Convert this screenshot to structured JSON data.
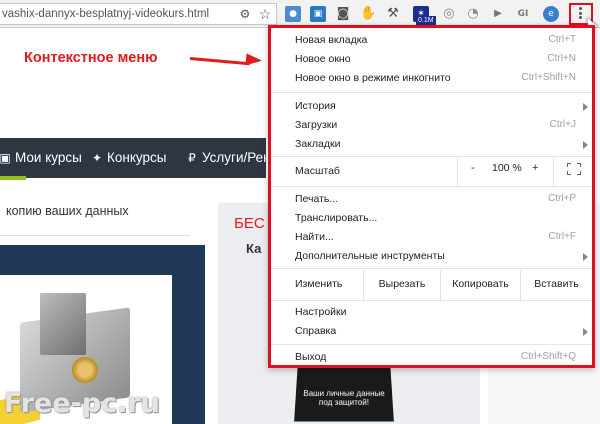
{
  "browser": {
    "url": "vashix-dannyx-besplatnyj-videokurs.html",
    "extension_badge": "0.1M"
  },
  "annotation": {
    "label": "Контекстное меню"
  },
  "site": {
    "nav": [
      {
        "label": "Мои курсы",
        "icon": "tv-icon"
      },
      {
        "label": "Конкурсы",
        "icon": "gift-icon"
      },
      {
        "label": "Услуги/Рек",
        "icon": "ruble-icon"
      }
    ],
    "backup_text": "копию ваших данных",
    "sidecard_title": "БЕС",
    "sidecard_subtitle": "Ка",
    "promo_text": "Ваши личные данные под защитой!",
    "watermark": "Free-pc.ru"
  },
  "context_menu": {
    "group1": [
      {
        "label": "Новая вкладка",
        "shortcut": "Ctrl+T"
      },
      {
        "label": "Новое окно",
        "shortcut": "Ctrl+N"
      },
      {
        "label": "Новое окно в режиме инкогнито",
        "shortcut": "Ctrl+Shift+N"
      }
    ],
    "group2": [
      {
        "label": "История",
        "shortcut": ""
      },
      {
        "label": "Загрузки",
        "shortcut": "Ctrl+J"
      },
      {
        "label": "Закладки",
        "shortcut": ""
      }
    ],
    "zoom": {
      "label": "Масштаб",
      "minus": "-",
      "value": "100 %",
      "plus": "+"
    },
    "group3": [
      {
        "label": "Печать...",
        "shortcut": "Ctrl+P"
      },
      {
        "label": "Транслировать...",
        "shortcut": ""
      },
      {
        "label": "Найти...",
        "shortcut": "Ctrl+F"
      },
      {
        "label": "Дополнительные инструменты",
        "shortcut": ""
      }
    ],
    "edit": {
      "label": "Изменить",
      "cut": "Вырезать",
      "copy": "Копировать",
      "paste": "Вставить"
    },
    "group4": [
      {
        "label": "Настройки",
        "shortcut": ""
      },
      {
        "label": "Справка",
        "shortcut": ""
      }
    ],
    "exit": {
      "label": "Выход",
      "shortcut": "Ctrl+Shift+Q"
    }
  },
  "colors": {
    "highlight_red": "#e00f1f",
    "navbar": "#2e3641",
    "nav_accent": "#94c120"
  }
}
